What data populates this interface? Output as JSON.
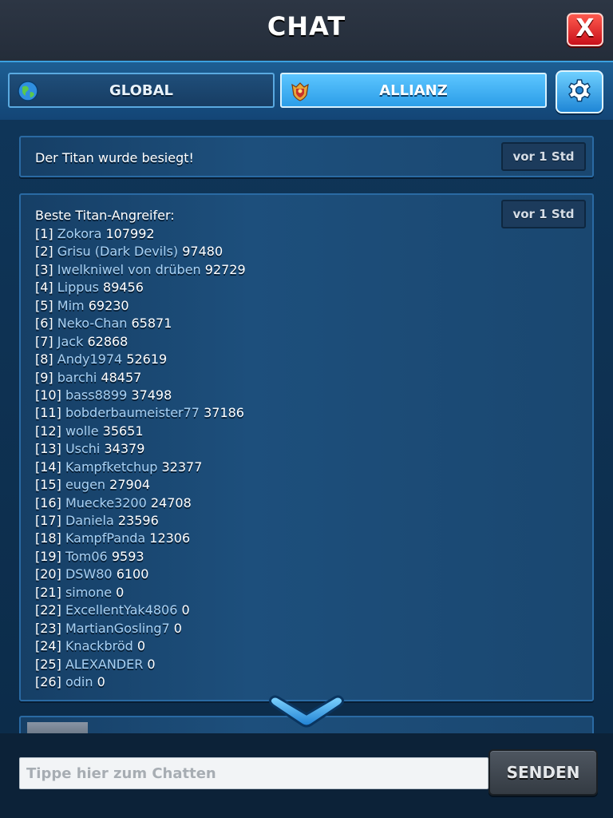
{
  "header": {
    "title": "CHAT",
    "close_label": "X"
  },
  "tabs": [
    {
      "label": "GLOBAL",
      "icon": "globe-icon",
      "active": false
    },
    {
      "label": "ALLIANZ",
      "icon": "alliance-crest-icon",
      "active": true
    }
  ],
  "settings": {
    "icon": "gear-icon"
  },
  "messages": {
    "titan_defeated": {
      "text": "Der Titan wurde besiegt!",
      "time": "vor 1 Std"
    },
    "ranking": {
      "title": "Beste Titan-Angreifer:",
      "time": "vor 1 Std",
      "entries": [
        {
          "rank": "[1]",
          "name": "Zokora",
          "score": "107992"
        },
        {
          "rank": "[2]",
          "name": "Grisu (Dark Devils)",
          "score": "97480"
        },
        {
          "rank": "[3]",
          "name": "Iwelkniwel von drüben",
          "score": "92729"
        },
        {
          "rank": "[4]",
          "name": "Lippus",
          "score": "89456"
        },
        {
          "rank": "[5]",
          "name": "Mim",
          "score": "69230"
        },
        {
          "rank": "[6]",
          "name": "Neko-Chan",
          "score": "65871"
        },
        {
          "rank": "[7]",
          "name": "Jack",
          "score": "62868"
        },
        {
          "rank": "[8]",
          "name": "Andy1974",
          "score": "52619"
        },
        {
          "rank": "[9]",
          "name": "barchi",
          "score": "48457"
        },
        {
          "rank": "[10]",
          "name": "bass8899",
          "score": "37498"
        },
        {
          "rank": "[11]",
          "name": "bobderbaumeister77",
          "score": "37186"
        },
        {
          "rank": "[12]",
          "name": "wolle",
          "score": "35651"
        },
        {
          "rank": "[13]",
          "name": "Uschi",
          "score": "34379"
        },
        {
          "rank": "[14]",
          "name": "Kampfketchup",
          "score": "32377"
        },
        {
          "rank": "[15]",
          "name": "eugen",
          "score": "27904"
        },
        {
          "rank": "[16]",
          "name": "Muecke3200",
          "score": "24708"
        },
        {
          "rank": "[17]",
          "name": "Daniela",
          "score": "23596"
        },
        {
          "rank": "[18]",
          "name": "KampfPanda",
          "score": "12306"
        },
        {
          "rank": "[19]",
          "name": "Tom06",
          "score": "9593"
        },
        {
          "rank": "[20]",
          "name": "DSW80",
          "score": "6100"
        },
        {
          "rank": "[21]",
          "name": "simone",
          "score": "0"
        },
        {
          "rank": "[22]",
          "name": "ExcellentYak4806",
          "score": "0"
        },
        {
          "rank": "[23]",
          "name": "MartianGosling7",
          "score": "0"
        },
        {
          "rank": "[24]",
          "name": "Knackbröd",
          "score": "0"
        },
        {
          "rank": "[25]",
          "name": "ALEXANDER",
          "score": "0"
        },
        {
          "rank": "[26]",
          "name": "odin",
          "score": "0"
        }
      ]
    }
  },
  "input": {
    "placeholder": "Tippe hier zum Chatten",
    "value": ""
  },
  "send_label": "SENDEN",
  "colors": {
    "accent": "#3aa0e0",
    "close": "#d8191f",
    "name_link": "#a9d1f3"
  }
}
